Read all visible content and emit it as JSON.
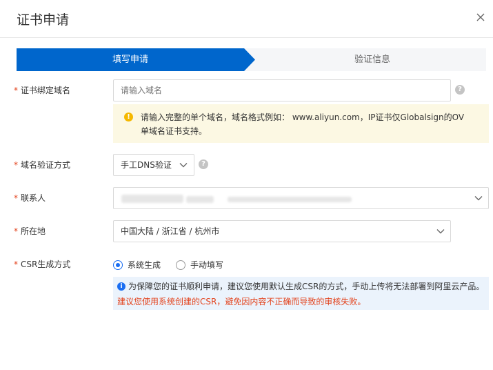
{
  "dialog": {
    "title": "证书申请",
    "close_icon": "close-icon"
  },
  "steps": [
    {
      "label": "填写申请",
      "active": true
    },
    {
      "label": "验证信息",
      "active": false
    }
  ],
  "colors": {
    "primary": "#1a6ef2",
    "step_active": "#0066cc",
    "required": "#e3431d",
    "warning_bg": "#fcf8e3",
    "info_bg": "#ebf3fc"
  },
  "form": {
    "domain": {
      "label": "证书绑定域名",
      "required_mark": "*",
      "placeholder": "请输入域名",
      "value": "",
      "help_icon": "question-icon"
    },
    "domain_notice": {
      "icon": "warning-icon",
      "text": "请输入完整的单个域名，域名格式例如： www.aliyun.com，IP证书仅Globalsign的OV单域名证书支持。"
    },
    "verify_method": {
      "label": "域名验证方式",
      "required_mark": "*",
      "value": "手工DNS验证",
      "help_icon": "question-icon"
    },
    "contact": {
      "label": "联系人",
      "required_mark": "*",
      "value_redacted": true
    },
    "location": {
      "label": "所在地",
      "required_mark": "*",
      "value": "中国大陆 / 浙江省 / 杭州市"
    },
    "csr": {
      "label": "CSR生成方式",
      "required_mark": "*",
      "options": [
        {
          "label": "系统生成",
          "selected": true
        },
        {
          "label": "手动填写",
          "selected": false
        }
      ],
      "info_icon": "info-icon",
      "info_text": "为保障您的证书顺利申请，建议您使用默认生成CSR的方式，手动上传将无法部署到阿里云产品。",
      "warning_text": "建议您使用系统创建的CSR，避免因内容不正确而导致的审核失败。"
    }
  }
}
